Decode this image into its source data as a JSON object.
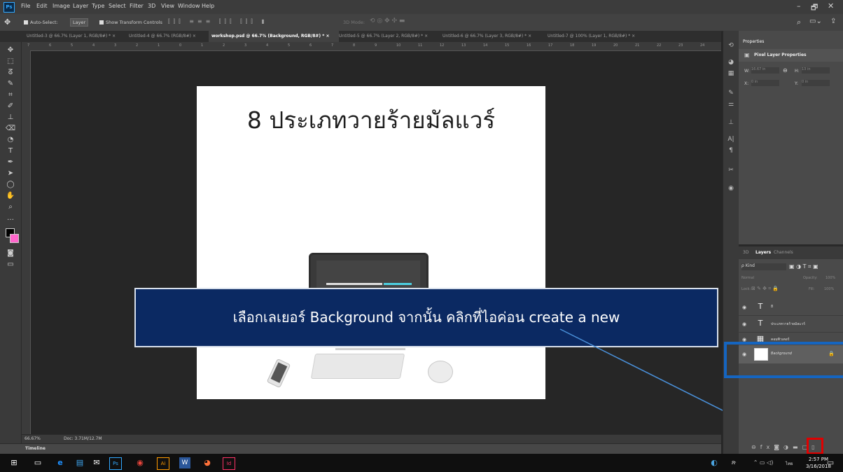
{
  "app": {
    "logo": "Ps",
    "menu": [
      "File",
      "Edit",
      "Image",
      "Layer",
      "Type",
      "Select",
      "Filter",
      "3D",
      "View",
      "Window",
      "Help"
    ]
  },
  "window_controls": [
    "–",
    "🗗",
    "✕"
  ],
  "options_bar": {
    "auto_select_label": "Auto-Select:",
    "auto_select_value": "Layer",
    "transform_label": "Show Transform Controls",
    "mode_3d": "3D Mode:"
  },
  "tabs": [
    "Untitled-3 @ 66.7% (Layer 1, RGB/8#) * ×",
    "Untitled-4 @ 66.7% (RGB/8#) ×",
    "workshop.psd @ 66.7% (Background, RGB/8#) * ×",
    "Untitled-5 @ 66.7% (Layer 2, RGB/8#) * ×",
    "Untitled-6 @ 66.7% (Layer 3, RGB/8#) * ×",
    "Untitled-7 @ 100% (Layer 1, RGB/8#) * ×"
  ],
  "ruler_numbers": [
    "7",
    "6",
    "5",
    "4",
    "3",
    "2",
    "1",
    "0",
    "1",
    "2",
    "3",
    "4",
    "5",
    "6",
    "7",
    "8",
    "9",
    "10",
    "11",
    "12",
    "13",
    "14",
    "15",
    "16",
    "17",
    "18",
    "19",
    "20",
    "21",
    "22",
    "23",
    "24"
  ],
  "document": {
    "title": "8 ประเภทวายร้ายมัลแวร์"
  },
  "callout": {
    "text": "เลือกเลเยอร์ Background จากนั้น คลิกที่ไอค่อน create a new"
  },
  "status": {
    "zoom": "66.67%",
    "doc": "Doc: 3.71M/12.7M"
  },
  "timeline_label": "Timeline",
  "properties": {
    "tab": "Properties",
    "header": "Pixel Layer Properties",
    "w_label": "W:",
    "w_val": "16.67 in",
    "h_label": "H:",
    "h_val": "13 in",
    "x_label": "X:",
    "x_val": "0 in",
    "y_label": "Y:",
    "y_val": "0 in"
  },
  "layers_panel": {
    "tabs": [
      "3D",
      "Layers",
      "Channels"
    ],
    "kind_label": "ρ Kind",
    "blend": "Normal",
    "opacity_label": "Opacity:",
    "opacity_val": "100%",
    "lock_label": "Lock:",
    "fill_label": "Fill:",
    "fill_val": "100%",
    "layers": [
      {
        "thumb": "T",
        "name": "8"
      },
      {
        "thumb": "T",
        "name": "ประเภทวายร้ายมัลแวร์"
      },
      {
        "thumb": "▦",
        "name": "คอมพิวเตอร์"
      },
      {
        "thumb": "□",
        "name": "Background"
      }
    ]
  },
  "clock": {
    "time": "2:57 PM",
    "date": "3/16/2018",
    "lang": "ไทย"
  },
  "colors": {
    "accent": "#31a8ff",
    "callout_bg": "#0b2962",
    "highlight_blue": "#1565c0",
    "highlight_red": "#e00000"
  }
}
